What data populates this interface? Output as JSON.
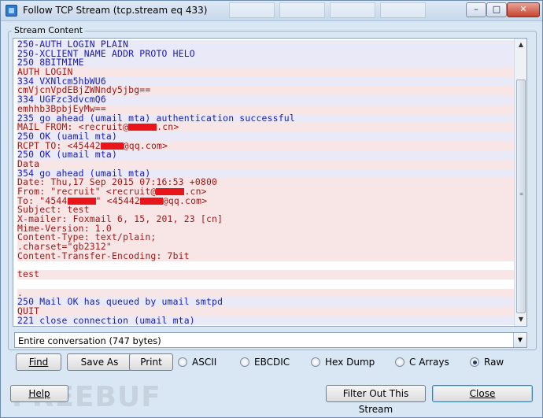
{
  "window": {
    "title": "Follow TCP Stream (tcp.stream eq 433)",
    "controls": {
      "minimize": "–",
      "maximize": "□",
      "close": "✕"
    }
  },
  "group": {
    "label": "Stream Content"
  },
  "stream": {
    "lines": [
      {
        "dir": "server",
        "text": "250-AUTH LOGIN PLAIN"
      },
      {
        "dir": "server",
        "text": "250-XCLIENT NAME ADDR PROTO HELO"
      },
      {
        "dir": "server",
        "text": "250 8BITMIME"
      },
      {
        "dir": "client",
        "text": "AUTH LOGIN"
      },
      {
        "dir": "server",
        "text": "334 VXNlcm5hbWU6"
      },
      {
        "dir": "client",
        "text": "cmVjcnVpdEBjZWNndy5jbg=="
      },
      {
        "dir": "server",
        "text": "334 UGFzc3dvcmQ6"
      },
      {
        "dir": "client",
        "text": "emhhb3BpbjEyMw=="
      },
      {
        "dir": "server",
        "text": "235 go ahead (umail mta) authentication successful"
      },
      {
        "dir": "client",
        "text": "MAIL FROM: <recruit@",
        "redact": 5,
        "after": ".cn>"
      },
      {
        "dir": "server",
        "text": "250 OK (uamil mta)"
      },
      {
        "dir": "client",
        "text": "RCPT TO: <45442",
        "redact": 4,
        "after": "@qq.com>"
      },
      {
        "dir": "server",
        "text": "250 OK (umail mta)"
      },
      {
        "dir": "client",
        "text": "Data"
      },
      {
        "dir": "server",
        "text": "354 go ahead (umail mta)"
      },
      {
        "dir": "client",
        "text": "Date: Thu,17 Sep 2015 07:16:53 +0800"
      },
      {
        "dir": "client",
        "text": "From: \"recruit\" <recruit@",
        "redact": 5,
        "after": ".cn>"
      },
      {
        "dir": "client",
        "text": "To: \"4544",
        "redact": 5,
        "after": "\" <45442",
        "redact2": 4,
        "after2": "@qq.com>"
      },
      {
        "dir": "client",
        "text": "Subject: test"
      },
      {
        "dir": "client",
        "text": "X-mailer: Foxmail 6, 15, 201, 23 [cn]"
      },
      {
        "dir": "client",
        "text": "Mime-Version: 1.0"
      },
      {
        "dir": "client",
        "text": "Content-Type: text/plain;"
      },
      {
        "dir": "client",
        "text": ".charset=\"gb2312\""
      },
      {
        "dir": "client",
        "text": "Content-Transfer-Encoding: 7bit"
      },
      {
        "dir": "blank",
        "text": ""
      },
      {
        "dir": "client",
        "text": "test"
      },
      {
        "dir": "blank",
        "text": ""
      },
      {
        "dir": "client",
        "text": "."
      },
      {
        "dir": "server",
        "text": "250 Mail OK has queued by umail smtpd"
      },
      {
        "dir": "client",
        "text": "QUIT"
      },
      {
        "dir": "server",
        "text": "221 close connection (umail mta)"
      }
    ],
    "colors": {
      "server_text": "#1a1ab4",
      "server_bg": "#e9e9f8",
      "client_text": "#a01818",
      "client_bg": "#f8e6e6"
    }
  },
  "conversation": {
    "selected": "Entire conversation (747 bytes)"
  },
  "buttons": {
    "find": "Find",
    "save_as": "Save As",
    "print": "Print",
    "help": "Help",
    "filter_out": "Filter Out This Stream",
    "close": "Close"
  },
  "format_options": [
    {
      "label": "ASCII",
      "checked": false
    },
    {
      "label": "EBCDIC",
      "checked": false
    },
    {
      "label": "Hex Dump",
      "checked": false
    },
    {
      "label": "C Arrays",
      "checked": false
    },
    {
      "label": "Raw",
      "checked": true
    }
  ],
  "watermark": "FREEBUF"
}
